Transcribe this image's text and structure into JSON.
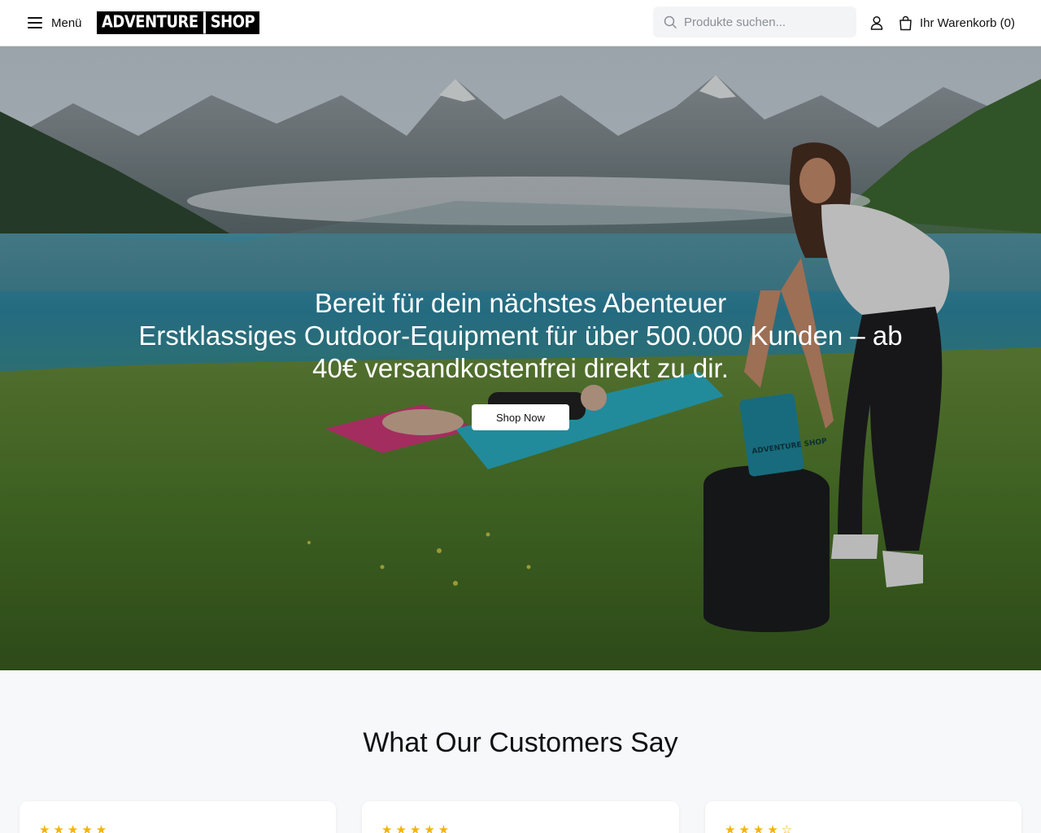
{
  "header": {
    "menu_label": "Menü",
    "logo_word1": "ADVENTURE",
    "logo_word2": "SHOP",
    "search_placeholder": "Produkte suchen...",
    "cart_label": "Ihr Warenkorb (0)"
  },
  "hero": {
    "title": "Bereit für dein nächstes Abenteuer",
    "subtitle": "Erstklassiges Outdoor-Equipment für über 500.000 Kunden – ab 40€ versandkostenfrei direkt zu dir.",
    "cta_label": "Shop Now",
    "bag_print": "ADVENTURE SHOP"
  },
  "testimonials": {
    "title": "What Our Customers Say",
    "cards": [
      {
        "stars": "★★★★★",
        "rating": 5
      },
      {
        "stars": "★★★★★",
        "rating": 5
      },
      {
        "stars": "★★★★☆",
        "rating": 4
      }
    ]
  },
  "colors": {
    "accent_star": "#f5b400",
    "header_bg": "#ffffff",
    "page_bg": "#f7f8fa"
  }
}
